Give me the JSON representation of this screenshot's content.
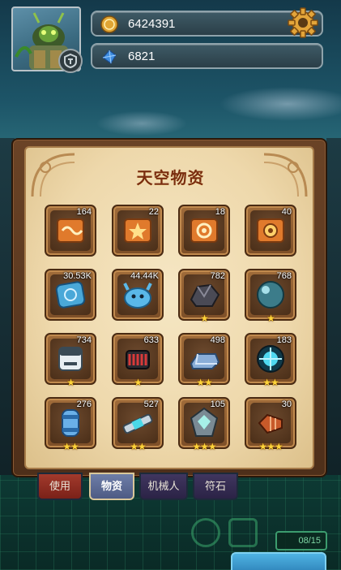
{
  "hud": {
    "gold": "6424391",
    "gems": "6821",
    "icons": {
      "gold": "coin-icon",
      "gems": "blue-crystal-icon",
      "settings": "gear-icon"
    }
  },
  "panel": {
    "title": "天空物资",
    "items": [
      {
        "name": "orange-scroll-wave",
        "count": "164",
        "stars": 0
      },
      {
        "name": "orange-scroll-star",
        "count": "22",
        "stars": 0
      },
      {
        "name": "orange-scroll-spiral",
        "count": "18",
        "stars": 0
      },
      {
        "name": "orange-scroll-gear",
        "count": "40",
        "stars": 0
      },
      {
        "name": "blue-rune-tablet",
        "count": "30.53K",
        "stars": 0
      },
      {
        "name": "blue-slime-creature",
        "count": "44.44K",
        "stars": 0
      },
      {
        "name": "dark-ore-chunk",
        "count": "782",
        "stars": 1
      },
      {
        "name": "teal-metal-orb",
        "count": "768",
        "stars": 1
      },
      {
        "name": "battery-module",
        "count": "734",
        "stars": 1
      },
      {
        "name": "red-coil-spool",
        "count": "633",
        "stars": 1
      },
      {
        "name": "metal-ingot",
        "count": "498",
        "stars": 2
      },
      {
        "name": "energy-core-orb",
        "count": "183",
        "stars": 2
      },
      {
        "name": "blue-canister",
        "count": "276",
        "stars": 2
      },
      {
        "name": "plasma-syringe",
        "count": "527",
        "stars": 2
      },
      {
        "name": "crystal-gem-cage",
        "count": "105",
        "stars": 3
      },
      {
        "name": "drill-head",
        "count": "30",
        "stars": 3
      }
    ]
  },
  "tabs": [
    {
      "label": "使用",
      "active": false
    },
    {
      "label": "物资",
      "active": true
    },
    {
      "label": "机械人",
      "active": false
    },
    {
      "label": "符石",
      "active": false
    }
  ],
  "bottom": {
    "capacity": "08/15"
  },
  "colors": {
    "panel_parchment": "#f0dcae",
    "title_red": "#7a2d0f",
    "star_gold": "#ffd43a",
    "active_tab": "#6e7ea8"
  }
}
